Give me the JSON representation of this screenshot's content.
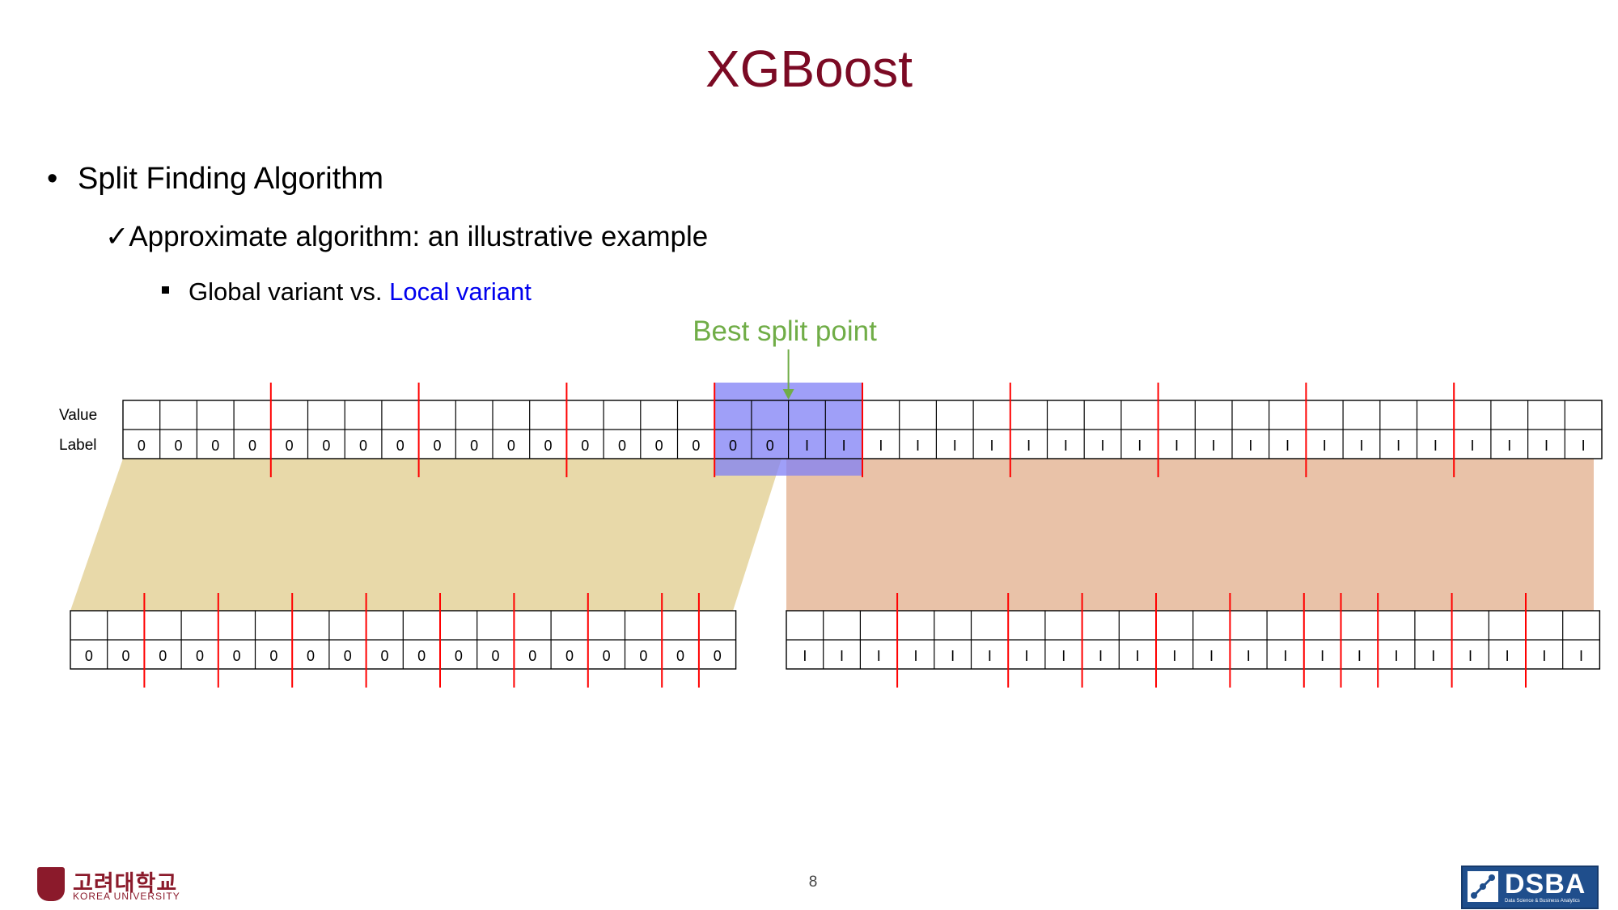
{
  "slide": {
    "title": "XGBoost",
    "bullet1": "Split Finding Algorithm",
    "bullet2": "Approximate algorithm: an illustrative example",
    "bullet3_prefix": "Global variant vs. ",
    "bullet3_highlight": "Local variant",
    "page_number": "8"
  },
  "diagram": {
    "best_split_label": "Best split point",
    "value_row_label": "Value",
    "label_row_label": "Label",
    "top_labels": [
      "0",
      "0",
      "0",
      "0",
      "0",
      "0",
      "0",
      "0",
      "0",
      "0",
      "0",
      "0",
      "0",
      "0",
      "0",
      "0",
      "0",
      "0",
      "1",
      "1",
      "1",
      "1",
      "1",
      "1",
      "1",
      "1",
      "1",
      "1",
      "1",
      "1",
      "1",
      "1",
      "1",
      "1",
      "1",
      "1",
      "1",
      "1",
      "1",
      "1"
    ],
    "bottom_left_labels": [
      "0",
      "0",
      "0",
      "0",
      "0",
      "0",
      "0",
      "0",
      "0",
      "0",
      "0",
      "0",
      "0",
      "0",
      "0",
      "0",
      "0",
      "0"
    ],
    "bottom_right_labels": [
      "1",
      "1",
      "1",
      "1",
      "1",
      "1",
      "1",
      "1",
      "1",
      "1",
      "1",
      "1",
      "1",
      "1",
      "1",
      "1",
      "1",
      "1",
      "1",
      "1",
      "1",
      "1"
    ],
    "colors": {
      "split_line": "#ff0000",
      "best_split_highlight": "#7f7ff5",
      "left_region": "#e8d9a9",
      "right_region": "#e9c2a8",
      "arrow": "#70ad47",
      "title": "#7b0a24"
    }
  },
  "footer": {
    "university_korean": "고려대학교",
    "university_english": "KOREA UNIVERSITY",
    "lab_name": "DSBA",
    "lab_subtitle": "Data Science & Business Analytics"
  }
}
